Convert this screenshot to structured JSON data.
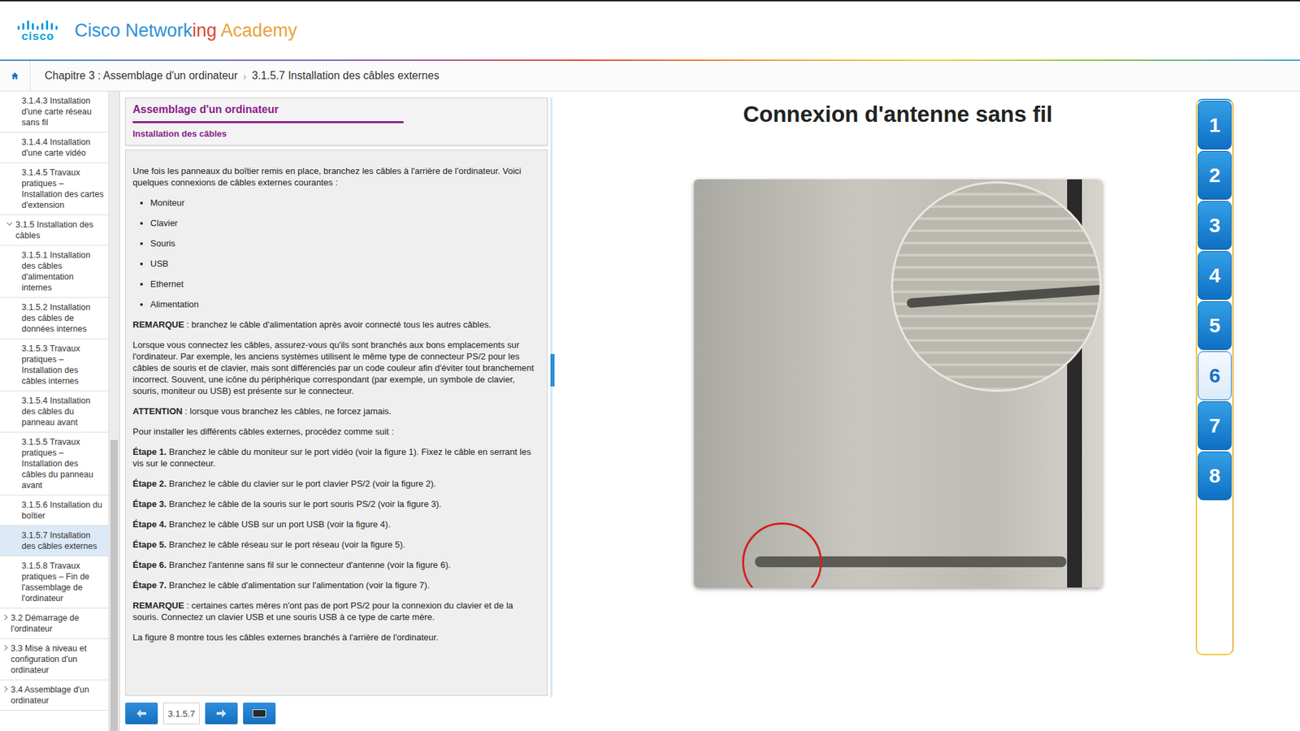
{
  "header": {
    "logo": "cisco",
    "title_parts": [
      {
        "text": "Cisco Network",
        "color": "#2b8fd6"
      },
      {
        "text": "ing",
        "color": "#e0452f"
      },
      {
        "text": " Academy",
        "color": "#e9a23b"
      }
    ]
  },
  "breadcrumb": [
    "Chapitre 3 : Assemblage d'un ordinateur",
    "3.1.5.7 Installation des câbles externes"
  ],
  "breadcrumb_separator": "›",
  "sidebar": {
    "items": [
      {
        "label": "3.1.4.3 Installation d'une carte réseau sans fil",
        "level": 2,
        "selected": false
      },
      {
        "label": "3.1.4.4 Installation d'une carte vidéo",
        "level": 2,
        "selected": false
      },
      {
        "label": "3.1.4.5 Travaux pratiques – Installation des cartes d'extension",
        "level": 2,
        "selected": false
      },
      {
        "label": "3.1.5 Installation des câbles",
        "level": 1,
        "selected": false,
        "expanded": true
      },
      {
        "label": "3.1.5.1 Installation des câbles d'alimentation internes",
        "level": 2,
        "selected": false
      },
      {
        "label": "3.1.5.2 Installation des câbles de données internes",
        "level": 2,
        "selected": false
      },
      {
        "label": "3.1.5.3 Travaux pratiques – Installation des câbles internes",
        "level": 2,
        "selected": false
      },
      {
        "label": "3.1.5.4 Installation des câbles du panneau avant",
        "level": 2,
        "selected": false
      },
      {
        "label": "3.1.5.5 Travaux pratiques – Installation des câbles du panneau avant",
        "level": 2,
        "selected": false
      },
      {
        "label": "3.1.5.6 Installation du boîtier",
        "level": 2,
        "selected": false
      },
      {
        "label": "3.1.5.7 Installation des câbles externes",
        "level": 2,
        "selected": true
      },
      {
        "label": "3.1.5.8 Travaux pratiques – Fin de l'assemblage de l'ordinateur",
        "level": 2,
        "selected": false
      },
      {
        "label": "3.2 Démarrage de l'ordinateur",
        "level": 0,
        "selected": false,
        "expanded": false
      },
      {
        "label": "3.3 Mise à niveau et configuration d'un ordinateur",
        "level": 0,
        "selected": false,
        "expanded": false
      },
      {
        "label": "3.4 Assemblage d'un ordinateur",
        "level": 0,
        "selected": false,
        "expanded": false
      }
    ]
  },
  "content": {
    "title": "Assemblage d'un ordinateur",
    "subtitle": "Installation des câbles",
    "blocks": [
      {
        "kind": "p",
        "lead": "",
        "text": "Une fois les panneaux du boîtier remis en place, branchez les câbles à l'arrière de l'ordinateur. Voici quelques connexions de câbles externes courantes :"
      },
      {
        "kind": "list",
        "items": [
          "Moniteur",
          "Clavier",
          "Souris",
          "USB",
          "Ethernet",
          "Alimentation"
        ]
      },
      {
        "kind": "p",
        "lead": "REMARQUE",
        "text": " : branchez le câble d'alimentation après avoir connecté tous les autres câbles."
      },
      {
        "kind": "p",
        "lead": "",
        "text": "Lorsque vous connectez les câbles, assurez-vous qu'ils sont branchés aux bons emplacements sur l'ordinateur. Par exemple, les anciens systèmes utilisent le même type de connecteur PS/2 pour les câbles de souris et de clavier, mais sont différenciés par un code couleur afin d'éviter tout branchement incorrect. Souvent, une icône du périphérique correspondant (par exemple, un symbole de clavier, souris, moniteur ou USB) est présente sur le connecteur."
      },
      {
        "kind": "p",
        "lead": "ATTENTION",
        "text": " : lorsque vous branchez les câbles, ne forcez jamais."
      },
      {
        "kind": "p",
        "lead": "",
        "text": "Pour installer les différents câbles externes, procédez comme suit :"
      },
      {
        "kind": "p",
        "lead": "Étape 1.",
        "text": " Branchez le câble du moniteur sur le port vidéo (voir la figure 1). Fixez le câble en serrant les vis sur le connecteur."
      },
      {
        "kind": "p",
        "lead": "Étape 2.",
        "text": " Branchez le câble du clavier sur le port clavier PS/2 (voir la figure 2)."
      },
      {
        "kind": "p",
        "lead": "Étape 3.",
        "text": " Branchez le câble de la souris sur le port souris PS/2 (voir la figure 3)."
      },
      {
        "kind": "p",
        "lead": "Étape 4.",
        "text": " Branchez le câble USB sur un port USB (voir la figure 4)."
      },
      {
        "kind": "p",
        "lead": "Étape 5.",
        "text": " Branchez le câble réseau sur le port réseau (voir la figure 5)."
      },
      {
        "kind": "p",
        "lead": "Étape 6.",
        "text": " Branchez l'antenne sans fil sur le connecteur d'antenne (voir la figure 6)."
      },
      {
        "kind": "p",
        "lead": "Étape 7.",
        "text": " Branchez le câble d'alimentation sur l'alimentation (voir la figure 7)."
      },
      {
        "kind": "p",
        "lead": "REMARQUE",
        "text": " : certaines cartes mères n'ont pas de port PS/2 pour la connexion du clavier et de la souris. Connectez un clavier USB et une souris USB à ce type de carte mère."
      },
      {
        "kind": "p",
        "lead": "",
        "text": "La figure 8 montre tous les câbles externes branchés à l'arrière de l'ordinateur."
      }
    ]
  },
  "footer": {
    "page": "3.1.5.7"
  },
  "figure": {
    "title": "Connexion d'antenne sans fil"
  },
  "figure_tabs": [
    {
      "label": "1",
      "selected": false
    },
    {
      "label": "2",
      "selected": false
    },
    {
      "label": "3",
      "selected": false
    },
    {
      "label": "4",
      "selected": false
    },
    {
      "label": "5",
      "selected": false
    },
    {
      "label": "6",
      "selected": true
    },
    {
      "label": "7",
      "selected": false
    },
    {
      "label": "8",
      "selected": false
    }
  ]
}
